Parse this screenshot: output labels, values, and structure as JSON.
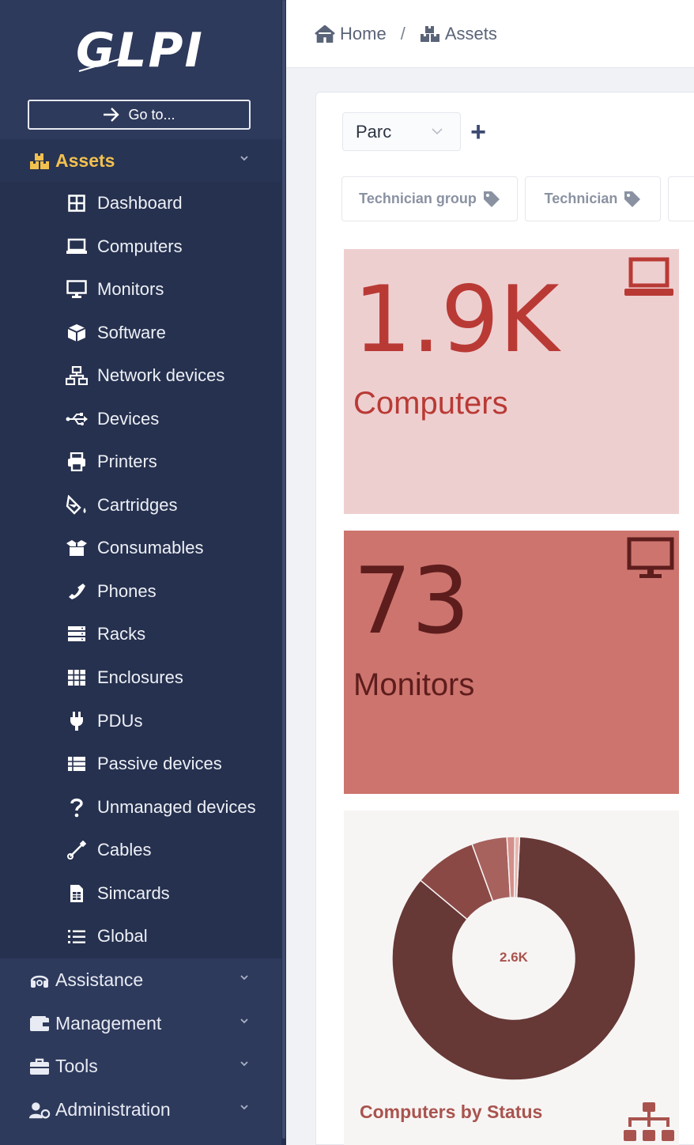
{
  "app": {
    "logo_text": "GLPI",
    "goto_label": "Go to..."
  },
  "sidebar": {
    "active_section": {
      "label": "Assets",
      "icon": "boxes-icon"
    },
    "asset_items": [
      {
        "label": "Dashboard",
        "icon": "dashboard-icon"
      },
      {
        "label": "Computers",
        "icon": "laptop-icon"
      },
      {
        "label": "Monitors",
        "icon": "desktop-icon"
      },
      {
        "label": "Software",
        "icon": "cube-icon"
      },
      {
        "label": "Network devices",
        "icon": "network-icon"
      },
      {
        "label": "Devices",
        "icon": "usb-icon"
      },
      {
        "label": "Printers",
        "icon": "printer-icon"
      },
      {
        "label": "Cartridges",
        "icon": "fill-drip-icon"
      },
      {
        "label": "Consumables",
        "icon": "box-open-icon"
      },
      {
        "label": "Phones",
        "icon": "phone-icon"
      },
      {
        "label": "Racks",
        "icon": "server-icon"
      },
      {
        "label": "Enclosures",
        "icon": "grid-icon"
      },
      {
        "label": "PDUs",
        "icon": "plug-icon"
      },
      {
        "label": "Passive devices",
        "icon": "list-table-icon"
      },
      {
        "label": "Unmanaged devices",
        "icon": "question-icon"
      },
      {
        "label": "Cables",
        "icon": "cable-icon"
      },
      {
        "label": "Simcards",
        "icon": "sim-card-icon"
      },
      {
        "label": "Global",
        "icon": "list-icon"
      }
    ],
    "other_sections": [
      {
        "label": "Assistance",
        "icon": "headset-icon"
      },
      {
        "label": "Management",
        "icon": "wallet-icon"
      },
      {
        "label": "Tools",
        "icon": "briefcase-icon"
      },
      {
        "label": "Administration",
        "icon": "user-cog-icon"
      }
    ]
  },
  "breadcrumb": {
    "home": "Home",
    "separator": "/",
    "current": "Assets"
  },
  "dashboard": {
    "selector_value": "Parc",
    "add_label": "+",
    "filters": [
      {
        "label": "Technician group"
      },
      {
        "label": "Technician"
      }
    ],
    "tiles": {
      "computers": {
        "value": "1.9K",
        "label": "Computers",
        "bg": "#eecfd0",
        "fg": "#b93a35"
      },
      "monitors": {
        "value": "73",
        "label": "Monitors",
        "bg": "#cd746e",
        "fg": "#5d1d1c"
      }
    }
  },
  "chart_data": {
    "type": "pie",
    "title": "Computers by Status",
    "center_label": "2.6K",
    "slices": [
      {
        "value": 0.82,
        "color": "#663836"
      },
      {
        "value": 0.08,
        "color": "#8b4946"
      },
      {
        "value": 0.045,
        "color": "#a8625e"
      },
      {
        "value": 0.01,
        "color": "#d4908b"
      },
      {
        "value": 0.006,
        "color": "#e8b5b1"
      }
    ]
  }
}
